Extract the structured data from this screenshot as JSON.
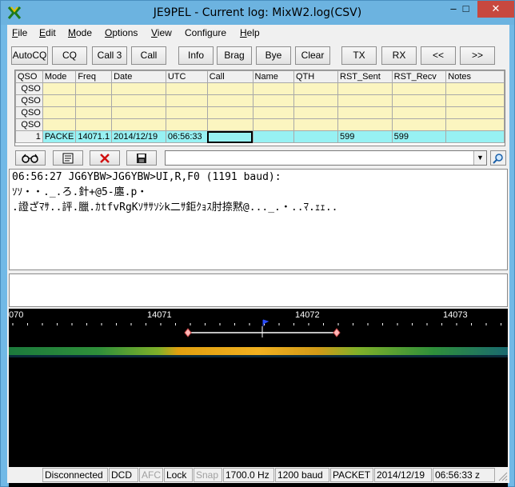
{
  "window": {
    "title": "JE9PEL - Current log: MixW2.log(CSV)",
    "minimize": "–",
    "maximize": "□",
    "close": "✕"
  },
  "menu": [
    "File",
    "Edit",
    "Mode",
    "Options",
    "View",
    "Configure",
    "Help"
  ],
  "menu_hotkeys": [
    "F",
    "E",
    "M",
    "O",
    "V",
    "g",
    "H"
  ],
  "toolbar": {
    "autocq": "AutoCQ",
    "cq": "CQ",
    "call3": "Call 3",
    "call": "Call",
    "info": "Info",
    "brag": "Brag",
    "bye": "Bye",
    "clear": "Clear",
    "tx": "TX",
    "rx": "RX",
    "prev": "<<",
    "next": ">>"
  },
  "grid": {
    "headers": [
      "QSO",
      "Mode",
      "Freq",
      "Date",
      "UTC",
      "Call",
      "Name",
      "QTH",
      "RST_Sent",
      "RST_Recv",
      "Notes"
    ],
    "empty_rows": [
      "QSO",
      "QSO",
      "QSO",
      "QSO"
    ],
    "active_row": {
      "num": "1",
      "mode": "PACKE",
      "freq": "14071.1",
      "date": "2014/12/19",
      "utc": "06:56:33",
      "call": "",
      "name": "",
      "qth": "",
      "rst_sent": "599",
      "rst_recv": "599",
      "notes": ""
    }
  },
  "icons": {
    "glasses": "glasses-icon",
    "notes": "notepad-icon",
    "delete": "delete-icon",
    "save": "save-icon",
    "search": "search-icon"
  },
  "rx_text": {
    "line1": "06:56:27 JG6YBW>JG6YBW>UI,R,F0 (1191 baud):",
    "line2": "ｿｿ・・._.ろ.針+@5-廛.p・",
    "line3": ".證ざﾏｻ..評.臘.ｶtfvRgKｿｻｻｿｼk二ｻ鉅ｸｮｽ肘捺黙@..._.・..ﾏ.ｪｪ.."
  },
  "waterfall": {
    "scale_labels": [
      "070",
      "14071",
      "14072",
      "14073"
    ],
    "marker_color": "#1a3cff"
  },
  "status": {
    "connection": "Disconnected",
    "dcd": "DCD",
    "afc": "AFC",
    "lock": "Lock",
    "snap": "Snap",
    "freq": "1700.0 Hz",
    "baud": "1200 baud",
    "mode": "PACKET",
    "date": "2014/12/19",
    "time": "06:56:33 z"
  }
}
